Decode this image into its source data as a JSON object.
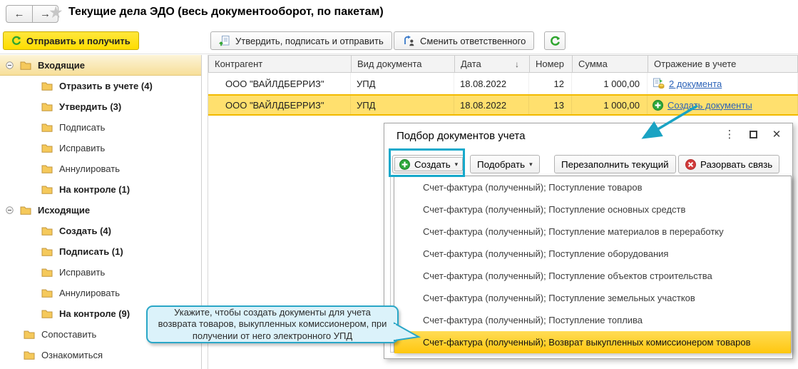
{
  "header": {
    "title": "Текущие дела ЭДО (весь документооборот, по пакетам)"
  },
  "icons": {
    "back": "←",
    "forward": "→",
    "star": "★",
    "sort_desc": "↓",
    "caret": "▾",
    "more": "⋮",
    "close": "✕"
  },
  "colors": {
    "accent_yellow": "#FFDD00",
    "selection_row": "#FFE06E",
    "menu_highlight": "#FFC70F",
    "annotation_teal": "#17A9CB",
    "link_blue": "#2C63B8",
    "folder": "#F5C95B",
    "green": "#2EA52E",
    "red": "#D23B3B"
  },
  "commandbar": {
    "send_receive": "Отправить и получить",
    "approve_sign_send": "Утвердить, подписать и отправить",
    "change_responsible": "Сменить ответственного"
  },
  "sidebar": {
    "items": [
      {
        "label": "Входящие",
        "bold": true,
        "type": "group",
        "selected": true
      },
      {
        "label": "Отразить в учете (4)",
        "bold": true,
        "type": "sub"
      },
      {
        "label": "Утвердить (3)",
        "bold": true,
        "type": "sub"
      },
      {
        "label": "Подписать",
        "bold": false,
        "type": "sub"
      },
      {
        "label": "Исправить",
        "bold": false,
        "type": "sub"
      },
      {
        "label": "Аннулировать",
        "bold": false,
        "type": "sub"
      },
      {
        "label": "На контроле (1)",
        "bold": true,
        "type": "sub"
      },
      {
        "label": "Исходящие",
        "bold": true,
        "type": "group"
      },
      {
        "label": "Создать (4)",
        "bold": true,
        "type": "sub"
      },
      {
        "label": "Подписать (1)",
        "bold": true,
        "type": "sub"
      },
      {
        "label": "Исправить",
        "bold": false,
        "type": "sub"
      },
      {
        "label": "Аннулировать",
        "bold": false,
        "type": "sub"
      },
      {
        "label": "На контроле (9)",
        "bold": true,
        "type": "sub"
      },
      {
        "label": "Сопоставить",
        "bold": false,
        "type": "leaf"
      },
      {
        "label": "Ознакомиться",
        "bold": false,
        "type": "leaf"
      }
    ]
  },
  "table": {
    "columns": [
      "Контрагент",
      "Вид документа",
      "Дата",
      "Номер",
      "Сумма",
      "Отражение в учете"
    ],
    "rows": [
      {
        "contractor": "ООО \"ВАЙЛДБЕРРИЗ\"",
        "doc_type": "УПД",
        "date": "18.08.2022",
        "number": "12",
        "amount": "1 000,00",
        "reflection": "2 документа"
      },
      {
        "contractor": "ООО \"ВАЙЛДБЕРРИЗ\"",
        "doc_type": "УПД",
        "date": "18.08.2022",
        "number": "13",
        "amount": "1 000,00",
        "reflection": "Создать документы"
      }
    ]
  },
  "dialog": {
    "title": "Подбор документов учета",
    "buttons": {
      "create": "Создать",
      "pick": "Подобрать",
      "refill": "Перезаполнить текущий",
      "break_link": "Разорвать связь"
    },
    "menu_items": [
      "Счет-фактура (полученный); Поступление товаров",
      "Счет-фактура (полученный); Поступление основных средств",
      "Счет-фактура (полученный); Поступление материалов в переработку",
      "Счет-фактура (полученный); Поступление оборудования",
      "Счет-фактура (полученный); Поступление объектов строительства",
      "Счет-фактура (полученный); Поступление земельных участков",
      "Счет-фактура (полученный); Поступление топлива",
      "Счет-фактура (полученный); Возврат выкупленных комиссионером товаров"
    ]
  },
  "tooltip": {
    "text": "Укажите, чтобы создать документы для учета возврата товаров, выкупленных комиссионером, при получении от него электронного УПД"
  }
}
